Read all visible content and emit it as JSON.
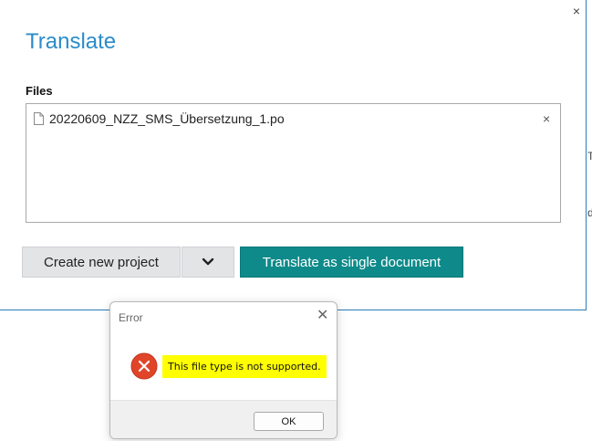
{
  "translate_dialog": {
    "title": "Translate",
    "close_glyph": "×",
    "files_label": "Files",
    "files": [
      {
        "name": "20220609_NZZ_SMS_Übersetzung_1.po",
        "icon": "file-icon",
        "remove_glyph": "×"
      }
    ],
    "buttons": {
      "create_project": "Create new project",
      "dropdown_icon": "chevron-down-icon",
      "translate_single": "Translate as single document"
    }
  },
  "error_dialog": {
    "title": "Error",
    "close_glyph": "✕",
    "icon": "error-icon",
    "message": "This file type is not supported.",
    "ok_label": "OK"
  },
  "background": {
    "fragments": [
      "T",
      "d"
    ]
  },
  "colors": {
    "title_blue": "#2b8cc9",
    "primary_teal": "#0f8a8a",
    "secondary_gray": "#e3e4e6",
    "error_red": "#e0452a",
    "highlight_yellow": "#ffff00"
  }
}
